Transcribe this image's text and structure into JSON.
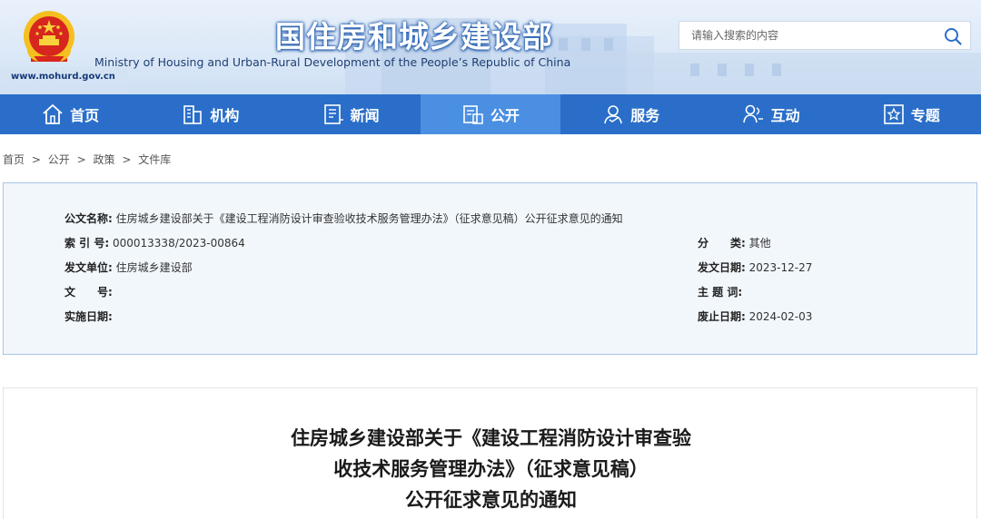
{
  "header": {
    "site_title": "国住房和城乡建设部",
    "site_subtitle": "Ministry of Housing and Urban-Rural Development of the People’s Republic of China",
    "site_url": "www.mohurd.gov.cn",
    "search_placeholder": "请输入搜索的内容",
    "emblem_icon": "national-emblem-icon",
    "search_icon": "search-icon"
  },
  "nav": {
    "items": [
      {
        "label": "首页",
        "icon": "home-icon",
        "active": false
      },
      {
        "label": "机构",
        "icon": "building-icon",
        "active": false
      },
      {
        "label": "新闻",
        "icon": "news-icon",
        "active": false
      },
      {
        "label": "公开",
        "icon": "disclosure-icon",
        "active": true
      },
      {
        "label": "服务",
        "icon": "service-icon",
        "active": false
      },
      {
        "label": "互动",
        "icon": "interaction-icon",
        "active": false
      },
      {
        "label": "专题",
        "icon": "topic-icon",
        "active": false
      }
    ]
  },
  "breadcrumb": [
    "首页",
    "公开",
    "政策",
    "文件库"
  ],
  "breadcrumb_sep": ">",
  "info": {
    "doc_name_label": "公文名称:",
    "doc_name": "住房城乡建设部关于《建设工程消防设计审查验收技术服务管理办法》（征求意见稿）公开征求意见的通知",
    "index_label": "索 引 号:",
    "index_value": "000013338/2023-00864",
    "issuer_label": "发文单位:",
    "issuer_value": "住房城乡建设部",
    "docno_label": "文　　号:",
    "docno_value": "",
    "effective_label": "实施日期:",
    "effective_value": "",
    "category_label": "分　　类:",
    "category_value": "其他",
    "issue_date_label": "发文日期:",
    "issue_date_value": "2023-12-27",
    "keywords_label": "主 题 词:",
    "keywords_value": "",
    "expiry_label": "废止日期:",
    "expiry_value": "2024-02-03"
  },
  "article": {
    "title_line1": "住房城乡建设部关于《建设工程消防设计审查验",
    "title_line2": "收技术服务管理办法》（征求意见稿）",
    "title_line3": "公开征求意见的通知"
  },
  "colors": {
    "nav_bg": "#2a6ec9",
    "nav_active": "#4b8fe3",
    "info_bg": "#f2f7fc",
    "info_border": "#a9c4e4"
  }
}
